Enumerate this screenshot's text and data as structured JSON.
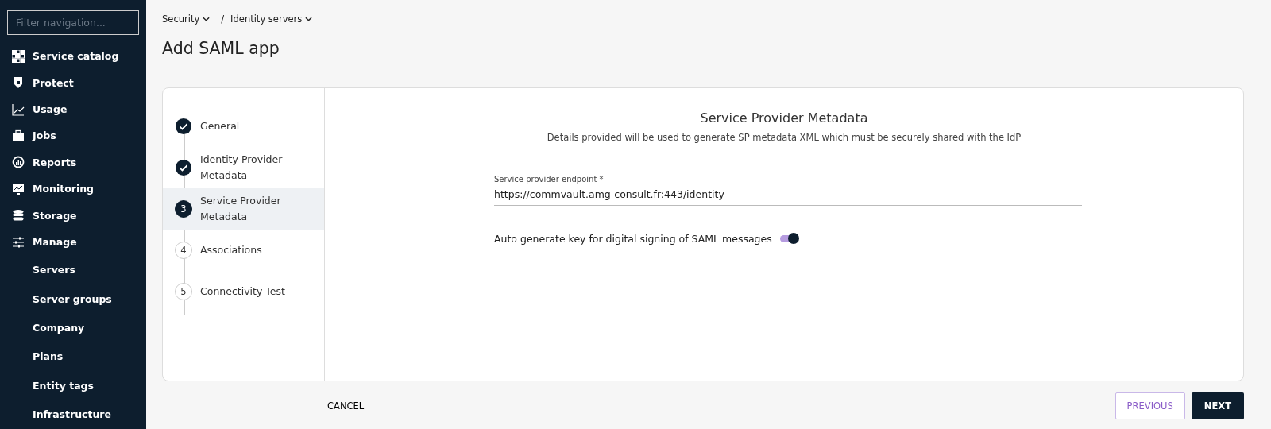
{
  "sidebar": {
    "filter": {
      "placeholder": "Filter navigation..."
    },
    "items": [
      {
        "label": "Service catalog"
      },
      {
        "label": "Protect"
      },
      {
        "label": "Usage"
      },
      {
        "label": "Jobs"
      },
      {
        "label": "Reports"
      },
      {
        "label": "Monitoring"
      },
      {
        "label": "Storage"
      },
      {
        "label": "Manage",
        "children": [
          {
            "label": "Servers"
          },
          {
            "label": "Server groups"
          },
          {
            "label": "Company"
          },
          {
            "label": "Plans"
          },
          {
            "label": "Entity tags"
          },
          {
            "label": "Infrastructure"
          }
        ]
      }
    ]
  },
  "breadcrumb": [
    {
      "label": "Security"
    },
    {
      "separator": "/",
      "label": "Identity servers"
    }
  ],
  "title": "Add SAML app",
  "steps": [
    {
      "label": "General",
      "kind": "done",
      "selected": false
    },
    {
      "label": "Identity Provider Metadata",
      "kind": "done",
      "selected": false
    },
    {
      "label": "Service Provider Metadata",
      "kind": "current",
      "number": "3",
      "selected": true
    },
    {
      "label": "Associations",
      "kind": "pending",
      "number": "4",
      "selected": false
    },
    {
      "label": "Connectivity Test",
      "kind": "pending",
      "number": "5",
      "selected": false
    }
  ],
  "form": {
    "heading": "Service Provider Metadata",
    "description": "Details provided will be used to generate SP metadata XML which must be securely shared with the IdP",
    "endpoint": {
      "label": "Service provider endpoint *",
      "value": "https://commvault.amg-consult.fr:443/identity"
    },
    "toggle": {
      "label": "Auto generate key for digital signing of SAML messages",
      "on": true
    }
  },
  "buttons": {
    "cancel": "CANCEL",
    "previous": "PREVIOUS",
    "next": "NEXT"
  }
}
